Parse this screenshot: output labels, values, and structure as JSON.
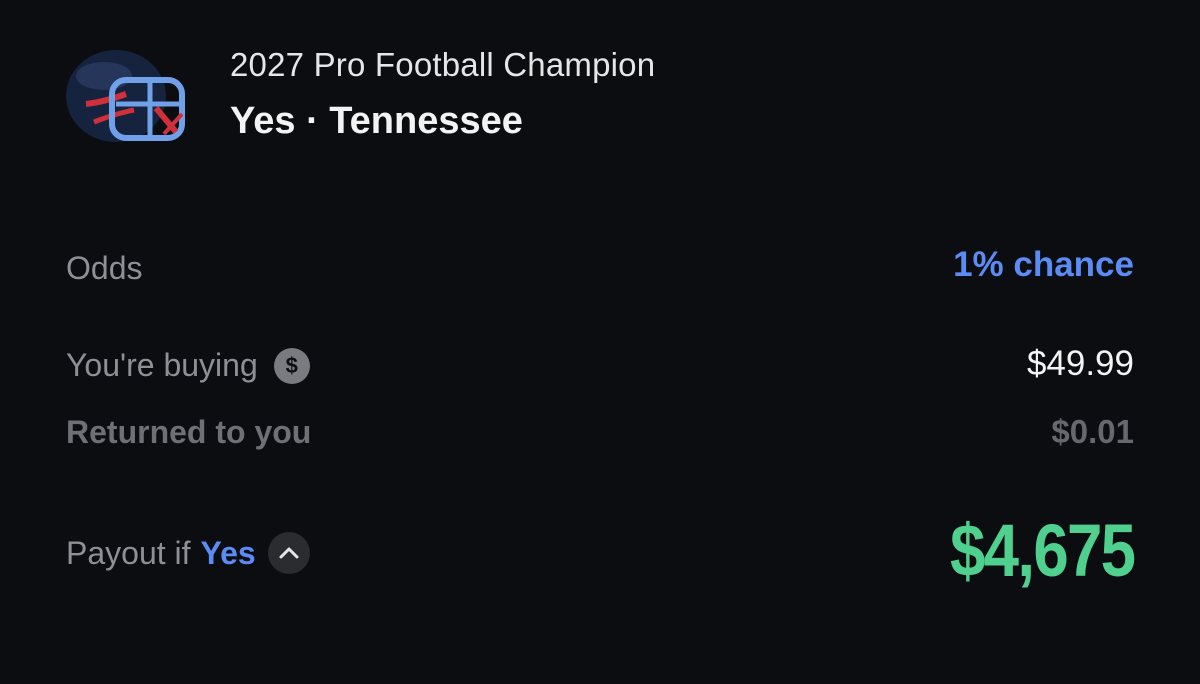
{
  "market": {
    "title": "2027 Pro Football Champion",
    "selection": "Yes · Tennessee",
    "helmet_icon": "football-helmet-icon"
  },
  "rows": {
    "odds": {
      "label": "Odds",
      "value": "1% chance"
    },
    "buying": {
      "label": "You're buying",
      "value": "$49.99",
      "icon": "dollar-circle-icon",
      "icon_glyph": "$"
    },
    "returned": {
      "label": "Returned to you",
      "value": "$0.01"
    },
    "payout": {
      "label_prefix": "Payout if",
      "label_outcome": "Yes",
      "value": "$4,675",
      "toggle_icon": "chevron-up-icon"
    }
  },
  "colors": {
    "background": "#0c0d10",
    "accent_blue": "#5b8cf6",
    "payout_green": "#4fd08e",
    "muted_text": "#8f9096"
  }
}
